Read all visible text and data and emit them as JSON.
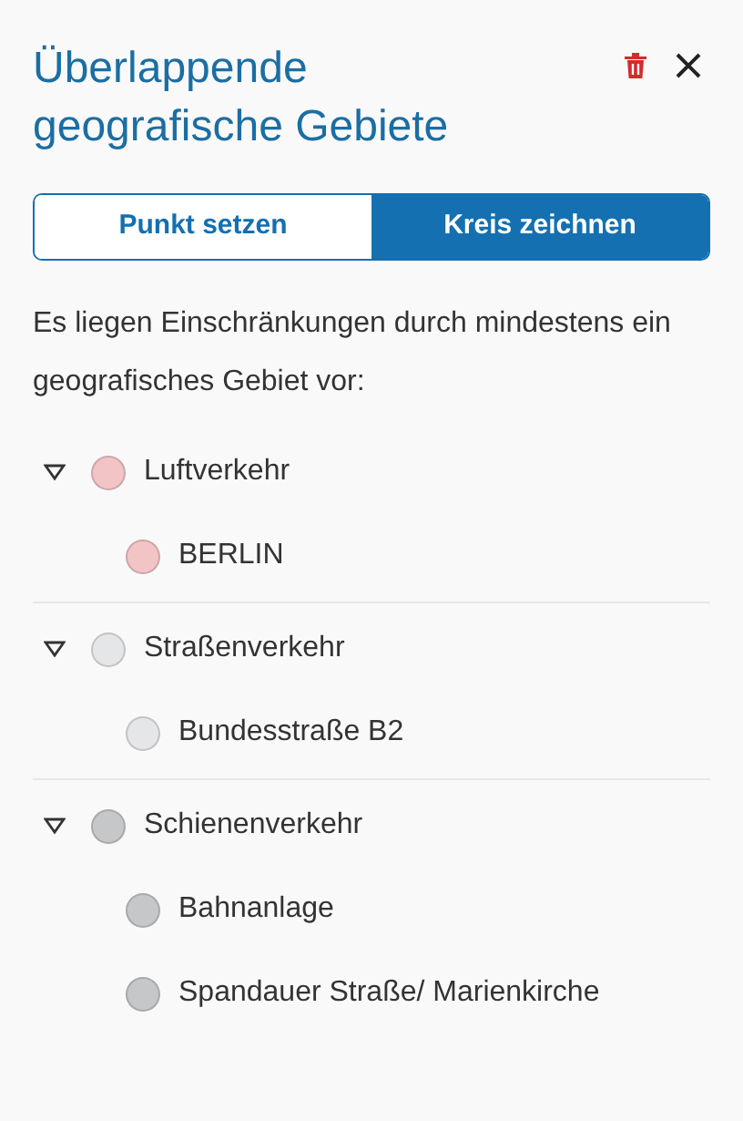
{
  "title": "Überlappende geografische Gebiete",
  "modes": [
    {
      "label": "Punkt setzen",
      "selected": false
    },
    {
      "label": "Kreis zeichnen",
      "selected": true
    }
  ],
  "description": "Es liegen Einschränkungen durch mindestens ein geografisches Gebiet vor:",
  "groups": [
    {
      "label": "Luftverkehr",
      "color": "#f2c4c6",
      "expanded": true,
      "children": [
        {
          "label": "BERLIN",
          "color": "#f2c4c6"
        }
      ]
    },
    {
      "label": "Straßenverkehr",
      "color": "#e5e6e8",
      "expanded": true,
      "children": [
        {
          "label": "Bundesstraße B2",
          "color": "#e5e6e8"
        }
      ]
    },
    {
      "label": "Schienenverkehr",
      "color": "#c6c7c9",
      "expanded": true,
      "children": [
        {
          "label": "Bahnanlage",
          "color": "#c6c7c9"
        },
        {
          "label": "Spandauer Straße/ Marienkirche",
          "color": "#c6c7c9"
        }
      ]
    }
  ]
}
